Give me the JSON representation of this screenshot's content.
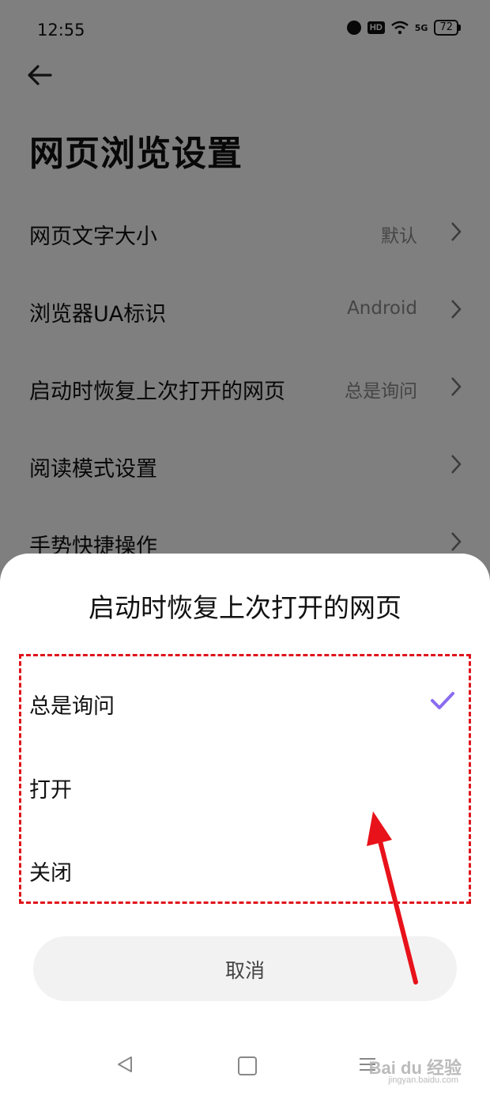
{
  "status_bar": {
    "time": "12:55",
    "hd_label": "HD",
    "signal_label": "5G",
    "battery": "72"
  },
  "page": {
    "title": "网页浏览设置"
  },
  "settings": [
    {
      "label": "网页文字大小",
      "value": "默认"
    },
    {
      "label": "浏览器UA标识",
      "value": "Android"
    },
    {
      "label": "启动时恢复上次打开的网页",
      "value": "总是询问"
    },
    {
      "label": "阅读模式设置",
      "value": ""
    },
    {
      "label": "手势快捷操作",
      "value": ""
    }
  ],
  "sheet": {
    "title": "启动时恢复上次打开的网页",
    "options": [
      {
        "label": "总是询问",
        "selected": true
      },
      {
        "label": "打开",
        "selected": false
      },
      {
        "label": "关闭",
        "selected": false
      }
    ],
    "cancel_label": "取消"
  },
  "colors": {
    "accent": "#8a6cf0",
    "annotation": "#e0141c"
  },
  "watermark": {
    "text": "Bai du 经验",
    "sub": "jingyan.baidu.com"
  }
}
